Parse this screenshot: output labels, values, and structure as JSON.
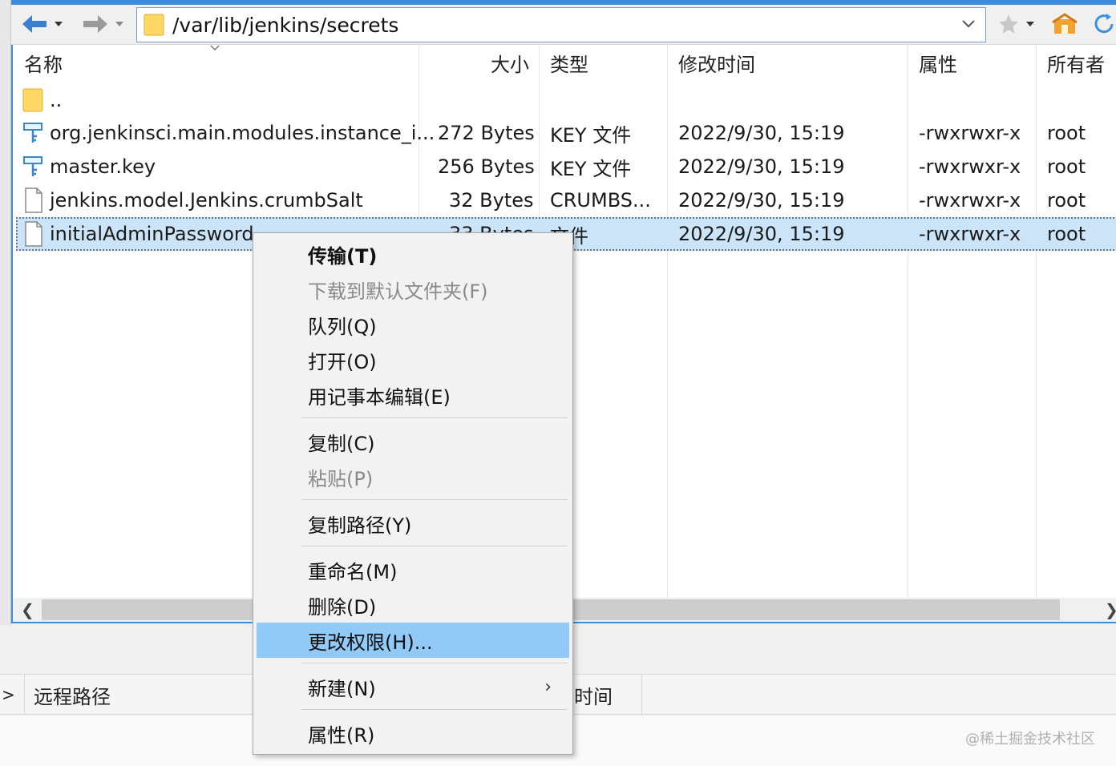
{
  "toolbar": {
    "address": "/var/lib/jenkins/secrets",
    "back_icon": "back-arrow-icon",
    "forward_icon": "forward-arrow-icon"
  },
  "columns": {
    "name": "名称",
    "size": "大小",
    "type": "类型",
    "modified": "修改时间",
    "attributes": "属性",
    "owner": "所有者"
  },
  "files": [
    {
      "name": "..",
      "size": "",
      "type": "",
      "modified": "",
      "attributes": "",
      "owner": "",
      "icon": "folder-icon"
    },
    {
      "name": "org.jenkinsci.main.modules.instance_i...",
      "size": "272 Bytes",
      "type": "KEY 文件",
      "modified": "2022/9/30, 15:19",
      "attributes": "-rwxrwxr-x",
      "owner": "root",
      "icon": "key-file-icon"
    },
    {
      "name": "master.key",
      "size": "256 Bytes",
      "type": "KEY 文件",
      "modified": "2022/9/30, 15:19",
      "attributes": "-rwxrwxr-x",
      "owner": "root",
      "icon": "key-file-icon"
    },
    {
      "name": "jenkins.model.Jenkins.crumbSalt",
      "size": "32 Bytes",
      "type": "CRUMBS...",
      "modified": "2022/9/30, 15:19",
      "attributes": "-rwxrwxr-x",
      "owner": "root",
      "icon": "file-icon"
    },
    {
      "name": "initialAdminPassword",
      "size": "33 Bytes",
      "type": "文件",
      "modified": "2022/9/30, 15:19",
      "attributes": "-rwxrwxr-x",
      "owner": "root",
      "icon": "file-icon"
    }
  ],
  "context_menu": {
    "transfer": "传输(T)",
    "download_default": "下载到默认文件夹(F)",
    "queue": "队列(Q)",
    "open": "打开(O)",
    "edit_notepad": "用记事本编辑(E)",
    "copy": "复制(C)",
    "paste": "粘贴(P)",
    "copy_path": "复制路径(Y)",
    "rename": "重命名(M)",
    "delete": "删除(D)",
    "change_permissions": "更改权限(H)...",
    "new": "新建(N)",
    "properties": "属性(R)"
  },
  "lower_panel": {
    "remote_path": "远程路径",
    "time_fragment": "时间",
    "left_marker": ">"
  },
  "watermark": "@稀土掘金技术社区"
}
